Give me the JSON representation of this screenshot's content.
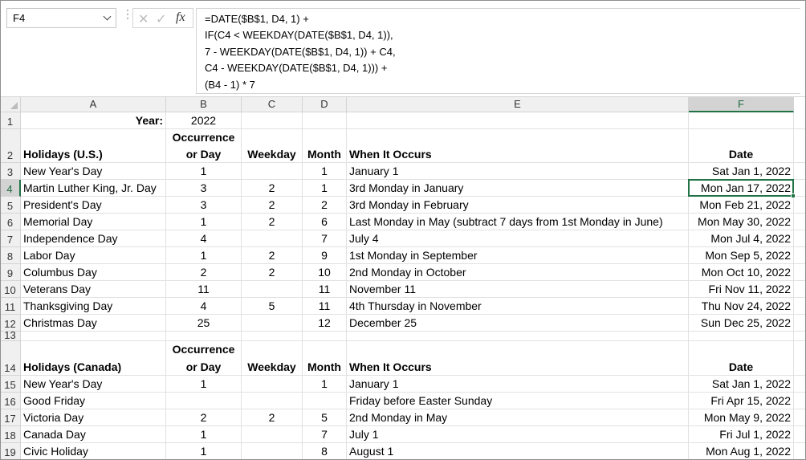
{
  "namebox": "F4",
  "fx_label": "fx",
  "formula_lines": [
    "=DATE($B$1, D4, 1) +",
    "IF(C4 < WEEKDAY(DATE($B$1, D4, 1)),",
    "7 - WEEKDAY(DATE($B$1, D4, 1)) + C4,",
    "C4 - WEEKDAY(DATE($B$1, D4, 1))) +",
    "(B4 - 1) * 7"
  ],
  "columns": [
    "A",
    "B",
    "C",
    "D",
    "E",
    "F"
  ],
  "rows": [
    "1",
    "2",
    "3",
    "4",
    "5",
    "6",
    "7",
    "8",
    "9",
    "10",
    "11",
    "12",
    "13",
    "14",
    "15",
    "16",
    "17",
    "18",
    "19"
  ],
  "year_label": "Year:",
  "year_value": "2022",
  "headers_us": {
    "a": "Holidays (U.S.)",
    "b1": "Occurrence",
    "b2": "or Day",
    "c": "Weekday",
    "d": "Month",
    "e": "When It Occurs",
    "f": "Date"
  },
  "us": [
    {
      "name": "New Year's Day",
      "occ": "1",
      "wd": "",
      "mo": "1",
      "when": "January 1",
      "date": "Sat Jan 1, 2022"
    },
    {
      "name": "Martin Luther King, Jr. Day",
      "occ": "3",
      "wd": "2",
      "mo": "1",
      "when": "3rd Monday in January",
      "date": "Mon Jan 17, 2022"
    },
    {
      "name": "President's Day",
      "occ": "3",
      "wd": "2",
      "mo": "2",
      "when": "3rd Monday in February",
      "date": "Mon Feb 21, 2022"
    },
    {
      "name": "Memorial Day",
      "occ": "1",
      "wd": "2",
      "mo": "6",
      "when": "Last Monday in May (subtract 7 days from 1st Monday in June)",
      "date": "Mon May 30, 2022"
    },
    {
      "name": "Independence Day",
      "occ": "4",
      "wd": "",
      "mo": "7",
      "when": "July 4",
      "date": "Mon Jul 4, 2022"
    },
    {
      "name": "Labor Day",
      "occ": "1",
      "wd": "2",
      "mo": "9",
      "when": "1st Monday in September",
      "date": "Mon Sep 5, 2022"
    },
    {
      "name": "Columbus Day",
      "occ": "2",
      "wd": "2",
      "mo": "10",
      "when": "2nd Monday in October",
      "date": "Mon Oct 10, 2022"
    },
    {
      "name": "Veterans Day",
      "occ": "11",
      "wd": "",
      "mo": "11",
      "when": "November 11",
      "date": "Fri Nov 11, 2022"
    },
    {
      "name": "Thanksgiving Day",
      "occ": "4",
      "wd": "5",
      "mo": "11",
      "when": "4th Thursday in November",
      "date": "Thu Nov 24, 2022"
    },
    {
      "name": "Christmas Day",
      "occ": "25",
      "wd": "",
      "mo": "12",
      "when": "December 25",
      "date": "Sun Dec 25, 2022"
    }
  ],
  "headers_ca": {
    "a": "Holidays (Canada)",
    "b1": "Occurrence",
    "b2": "or Day",
    "c": "Weekday",
    "d": "Month",
    "e": "When It Occurs",
    "f": "Date"
  },
  "ca": [
    {
      "name": "New Year's Day",
      "occ": "1",
      "wd": "",
      "mo": "1",
      "when": "January 1",
      "date": "Sat Jan 1, 2022"
    },
    {
      "name": "Good Friday",
      "occ": "",
      "wd": "",
      "mo": "",
      "when": "Friday before Easter Sunday",
      "date": "Fri Apr 15, 2022"
    },
    {
      "name": "Victoria Day",
      "occ": "2",
      "wd": "2",
      "mo": "5",
      "when": "2nd Monday in May",
      "date": "Mon May 9, 2022"
    },
    {
      "name": "Canada Day",
      "occ": "1",
      "wd": "",
      "mo": "7",
      "when": "July 1",
      "date": "Fri Jul 1, 2022"
    },
    {
      "name": "Civic Holiday",
      "occ": "1",
      "wd": "",
      "mo": "8",
      "when": "August 1",
      "date": "Mon Aug 1, 2022"
    }
  ]
}
